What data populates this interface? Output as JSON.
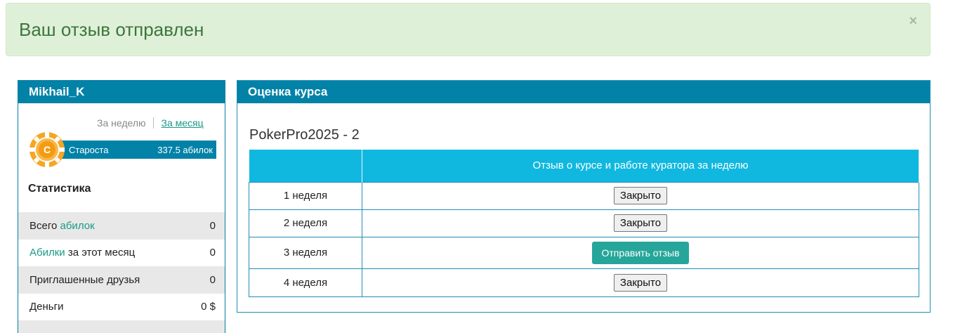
{
  "alert": {
    "message": "Ваш отзыв отправлен",
    "close": "×"
  },
  "user": {
    "name": "Mikhail_K",
    "tabs": {
      "week": "За неделю",
      "month": "За месяц"
    },
    "rank": {
      "badge": "C",
      "title": "Староста",
      "points": "337.5 абилок"
    },
    "stats_title": "Статистика",
    "stats": [
      {
        "before": "Всего ",
        "highlight": "абилок",
        "after": "",
        "value": "0"
      },
      {
        "before": "",
        "highlight": "Абилки",
        "after": " за этот месяц",
        "value": "0"
      },
      {
        "before": "Приглашенные друзья",
        "highlight": "",
        "after": "",
        "value": "0"
      },
      {
        "before": "Деньги",
        "highlight": "",
        "after": "",
        "value": "0 $"
      }
    ]
  },
  "course": {
    "panel_title": "Оценка курса",
    "name": "PokerPro2025 - 2",
    "table_header": {
      "week_col": "",
      "review_col": "Отзыв о курсе и работе куратора за неделю"
    },
    "weeks": [
      {
        "label": "1 неделя",
        "action": "Закрыто"
      },
      {
        "label": "2 неделя",
        "action": "Закрыто"
      },
      {
        "label": "3 неделя",
        "action": "Отправить отзыв"
      },
      {
        "label": "4 неделя",
        "action": "Закрыто"
      }
    ]
  },
  "colors": {
    "header_blue": "#0382a8",
    "table_header": "#10b8e0",
    "accent_teal": "#26a69a",
    "alert_bg": "#dff0d8",
    "alert_text": "#3c763d"
  }
}
